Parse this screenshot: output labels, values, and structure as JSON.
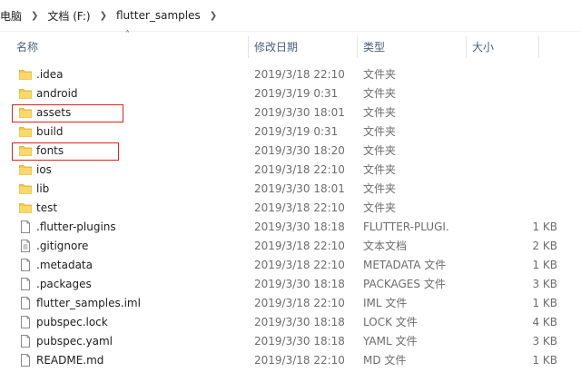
{
  "breadcrumb": {
    "items": [
      "电脑",
      "文档 (F:)",
      "flutter_samples"
    ],
    "separator_icon": "chevron-right-icon"
  },
  "columns": {
    "name": "名称",
    "modified": "修改日期",
    "type": "类型",
    "size": "大小",
    "sort_icon": "sort-ascending-icon"
  },
  "files": [
    {
      "name": ".idea",
      "modified": "2019/3/18 22:10",
      "type": "文件夹",
      "size": "",
      "icon": "folder-icon",
      "highlighted": false
    },
    {
      "name": "android",
      "modified": "2019/3/19 0:31",
      "type": "文件夹",
      "size": "",
      "icon": "folder-icon",
      "highlighted": false
    },
    {
      "name": "assets",
      "modified": "2019/3/30 18:01",
      "type": "文件夹",
      "size": "",
      "icon": "folder-icon",
      "highlighted": true
    },
    {
      "name": "build",
      "modified": "2019/3/19 0:31",
      "type": "文件夹",
      "size": "",
      "icon": "folder-icon",
      "highlighted": false
    },
    {
      "name": "fonts",
      "modified": "2019/3/30 18:20",
      "type": "文件夹",
      "size": "",
      "icon": "folder-icon",
      "highlighted": true
    },
    {
      "name": "ios",
      "modified": "2019/3/18 22:10",
      "type": "文件夹",
      "size": "",
      "icon": "folder-icon",
      "highlighted": false
    },
    {
      "name": "lib",
      "modified": "2019/3/30 18:01",
      "type": "文件夹",
      "size": "",
      "icon": "folder-icon",
      "highlighted": false
    },
    {
      "name": "test",
      "modified": "2019/3/18 22:10",
      "type": "文件夹",
      "size": "",
      "icon": "folder-icon",
      "highlighted": false
    },
    {
      "name": ".flutter-plugins",
      "modified": "2019/3/30 18:18",
      "type": "FLUTTER-PLUGI...",
      "size": "1 KB",
      "icon": "file-icon",
      "highlighted": false
    },
    {
      "name": ".gitignore",
      "modified": "2019/3/18 22:10",
      "type": "文本文档",
      "size": "2 KB",
      "icon": "text-file-icon",
      "highlighted": false
    },
    {
      "name": ".metadata",
      "modified": "2019/3/18 22:10",
      "type": "METADATA 文件",
      "size": "1 KB",
      "icon": "file-icon",
      "highlighted": false
    },
    {
      "name": ".packages",
      "modified": "2019/3/30 18:18",
      "type": "PACKAGES 文件",
      "size": "3 KB",
      "icon": "file-icon",
      "highlighted": false
    },
    {
      "name": "flutter_samples.iml",
      "modified": "2019/3/18 22:10",
      "type": "IML 文件",
      "size": "1 KB",
      "icon": "file-icon",
      "highlighted": false
    },
    {
      "name": "pubspec.lock",
      "modified": "2019/3/30 18:18",
      "type": "LOCK 文件",
      "size": "4 KB",
      "icon": "file-icon",
      "highlighted": false
    },
    {
      "name": "pubspec.yaml",
      "modified": "2019/3/30 18:18",
      "type": "YAML 文件",
      "size": "3 KB",
      "icon": "file-icon",
      "highlighted": false
    },
    {
      "name": "README.md",
      "modified": "2019/3/18 22:10",
      "type": "MD 文件",
      "size": "1 KB",
      "icon": "file-icon",
      "highlighted": false
    }
  ],
  "colors": {
    "folder": "#f5c94a",
    "highlight_border": "#e02020",
    "header_text": "#4c607a"
  }
}
